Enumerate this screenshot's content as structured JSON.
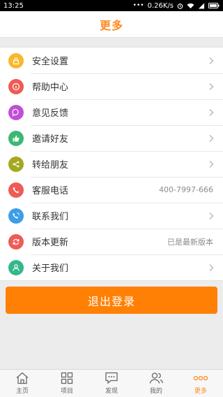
{
  "status_bar": {
    "time": "13:25",
    "network_speed": "0.26K/s"
  },
  "header": {
    "title": "更多"
  },
  "menu": {
    "items": [
      {
        "label": "安全设置",
        "icon": "lock-icon",
        "color": "#f9b82c",
        "value": ""
      },
      {
        "label": "帮助中心",
        "icon": "info-icon",
        "color": "#ef5b55",
        "value": ""
      },
      {
        "label": "意见反馈",
        "icon": "feedback-icon",
        "color": "#c04fd8",
        "value": ""
      },
      {
        "label": "邀请好友",
        "icon": "thumbs-up-icon",
        "color": "#3bb872",
        "value": ""
      },
      {
        "label": "转给朋友",
        "icon": "share-icon",
        "color": "#a4a81f",
        "value": ""
      },
      {
        "label": "客服电话",
        "icon": "phone-icon",
        "color": "#ef5b55",
        "value": "400-7997-666"
      },
      {
        "label": "联系我们",
        "icon": "contact-icon",
        "color": "#3d9ee8",
        "value": ""
      },
      {
        "label": "版本更新",
        "icon": "refresh-icon",
        "color": "#ef5b55",
        "value": "已是最新版本"
      },
      {
        "label": "关于我们",
        "icon": "person-icon",
        "color": "#34b889",
        "value": ""
      }
    ]
  },
  "logout": {
    "label": "退出登录"
  },
  "tabbar": {
    "tabs": [
      {
        "label": "主页",
        "icon": "home-icon"
      },
      {
        "label": "项目",
        "icon": "grid-icon"
      },
      {
        "label": "发现",
        "icon": "chat-icon"
      },
      {
        "label": "我的",
        "icon": "users-icon"
      },
      {
        "label": "更多",
        "icon": "more-dots-icon",
        "active": true
      }
    ]
  },
  "colors": {
    "accent": "#ff8a1f",
    "logout_button": "#ff8005"
  }
}
